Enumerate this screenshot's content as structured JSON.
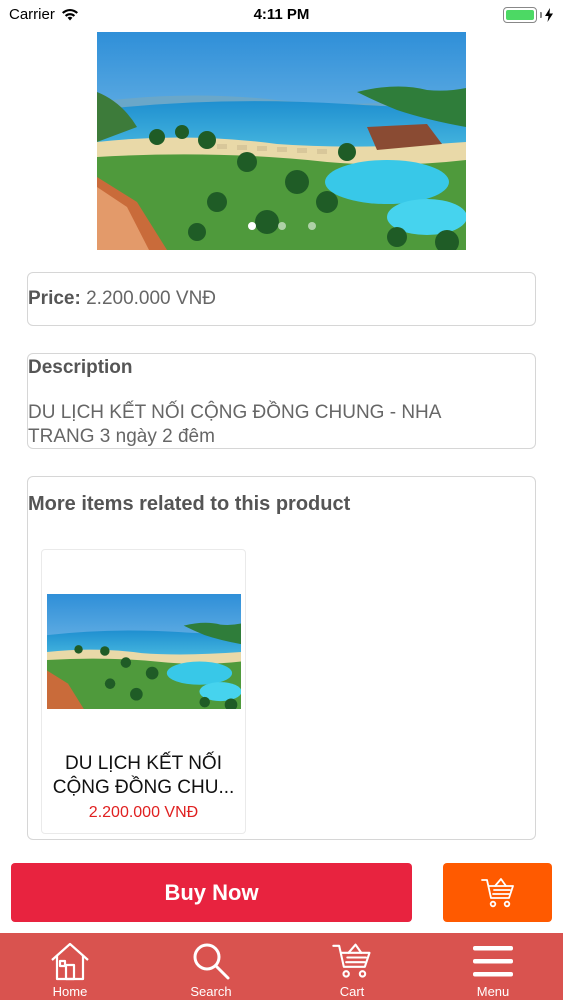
{
  "status": {
    "carrier": "Carrier",
    "time": "4:11 PM"
  },
  "hero": {
    "slide_count": 3,
    "active_slide": 1
  },
  "price": {
    "label": "Price:",
    "value": "2.200.000 VNĐ"
  },
  "description": {
    "title": "Description",
    "text": "DU LỊCH KẾT NỐI CỘNG ĐỒNG CHUNG - NHA TRANG 3 ngày 2 đêm"
  },
  "related": {
    "title": "More items related to this product",
    "items": [
      {
        "name": "DU LỊCH KẾT NỐI CỘNG ĐỒNG CHU...",
        "price": "2.200.000 VNĐ"
      }
    ]
  },
  "actions": {
    "buy_now": "Buy Now",
    "cart_icon": "cart-add-icon"
  },
  "tabbar": {
    "items": [
      {
        "label": "Home",
        "icon": "home-icon"
      },
      {
        "label": "Search",
        "icon": "search-icon"
      },
      {
        "label": "Cart",
        "icon": "cart-icon"
      },
      {
        "label": "Menu",
        "icon": "menu-icon"
      }
    ]
  },
  "colors": {
    "buy_now": "#e8233f",
    "cart_button": "#ff5a00",
    "tabbar": "#d9534f",
    "price_accent": "#e02020"
  }
}
